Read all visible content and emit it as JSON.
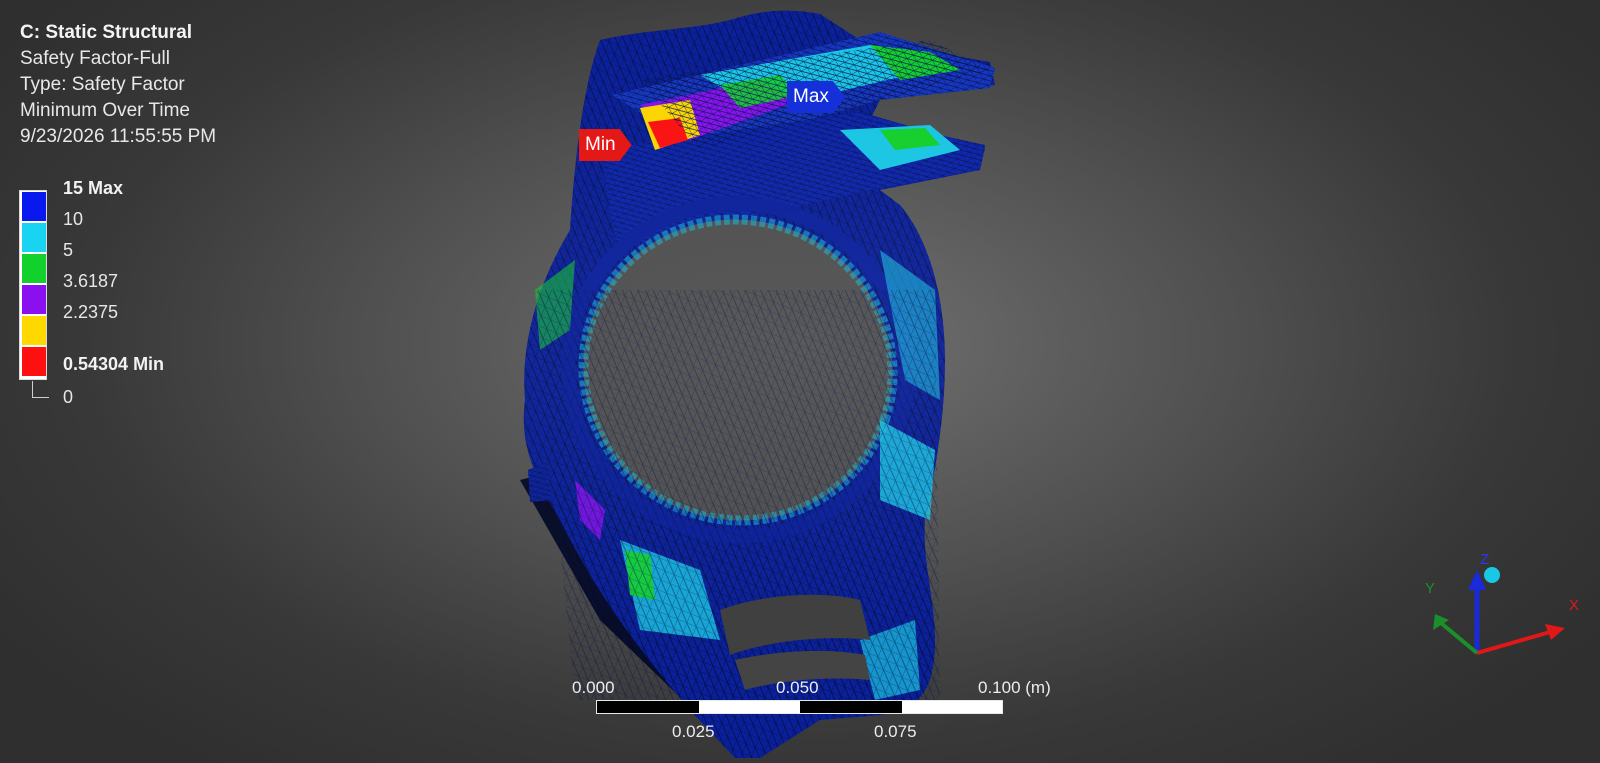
{
  "info": {
    "analysis": "C: Static Structural",
    "result": "Safety Factor-Full",
    "type": "Type: Safety Factor",
    "mode": "Minimum Over Time",
    "timestamp": "9/23/2026 11:55:55 PM"
  },
  "legend": {
    "labels": [
      "15 Max",
      "10",
      "5",
      "3.6187",
      "2.2375",
      "0.54304 Min",
      "0"
    ],
    "colors": [
      "#0a18f0",
      "#19d3f3",
      "#13d12c",
      "#8a10f0",
      "#ffd800",
      "#ff1010"
    ]
  },
  "probes": {
    "min_label": "Min",
    "max_label": "Max"
  },
  "scale": {
    "ticks_top": [
      "0.000",
      "0.050",
      "0.100 (m)"
    ],
    "ticks_bottom": [
      "0.025",
      "0.075"
    ]
  },
  "triad": {
    "x": "X",
    "y": "Y",
    "z": "Z"
  },
  "colors": {
    "mesh_base": "#0a1f9c",
    "mesh_line": "#021048",
    "accent_cyan": "#19c8e6",
    "axis_x": "#e01818",
    "axis_y": "#1a8f2a",
    "axis_z": "#1a2ad8"
  }
}
